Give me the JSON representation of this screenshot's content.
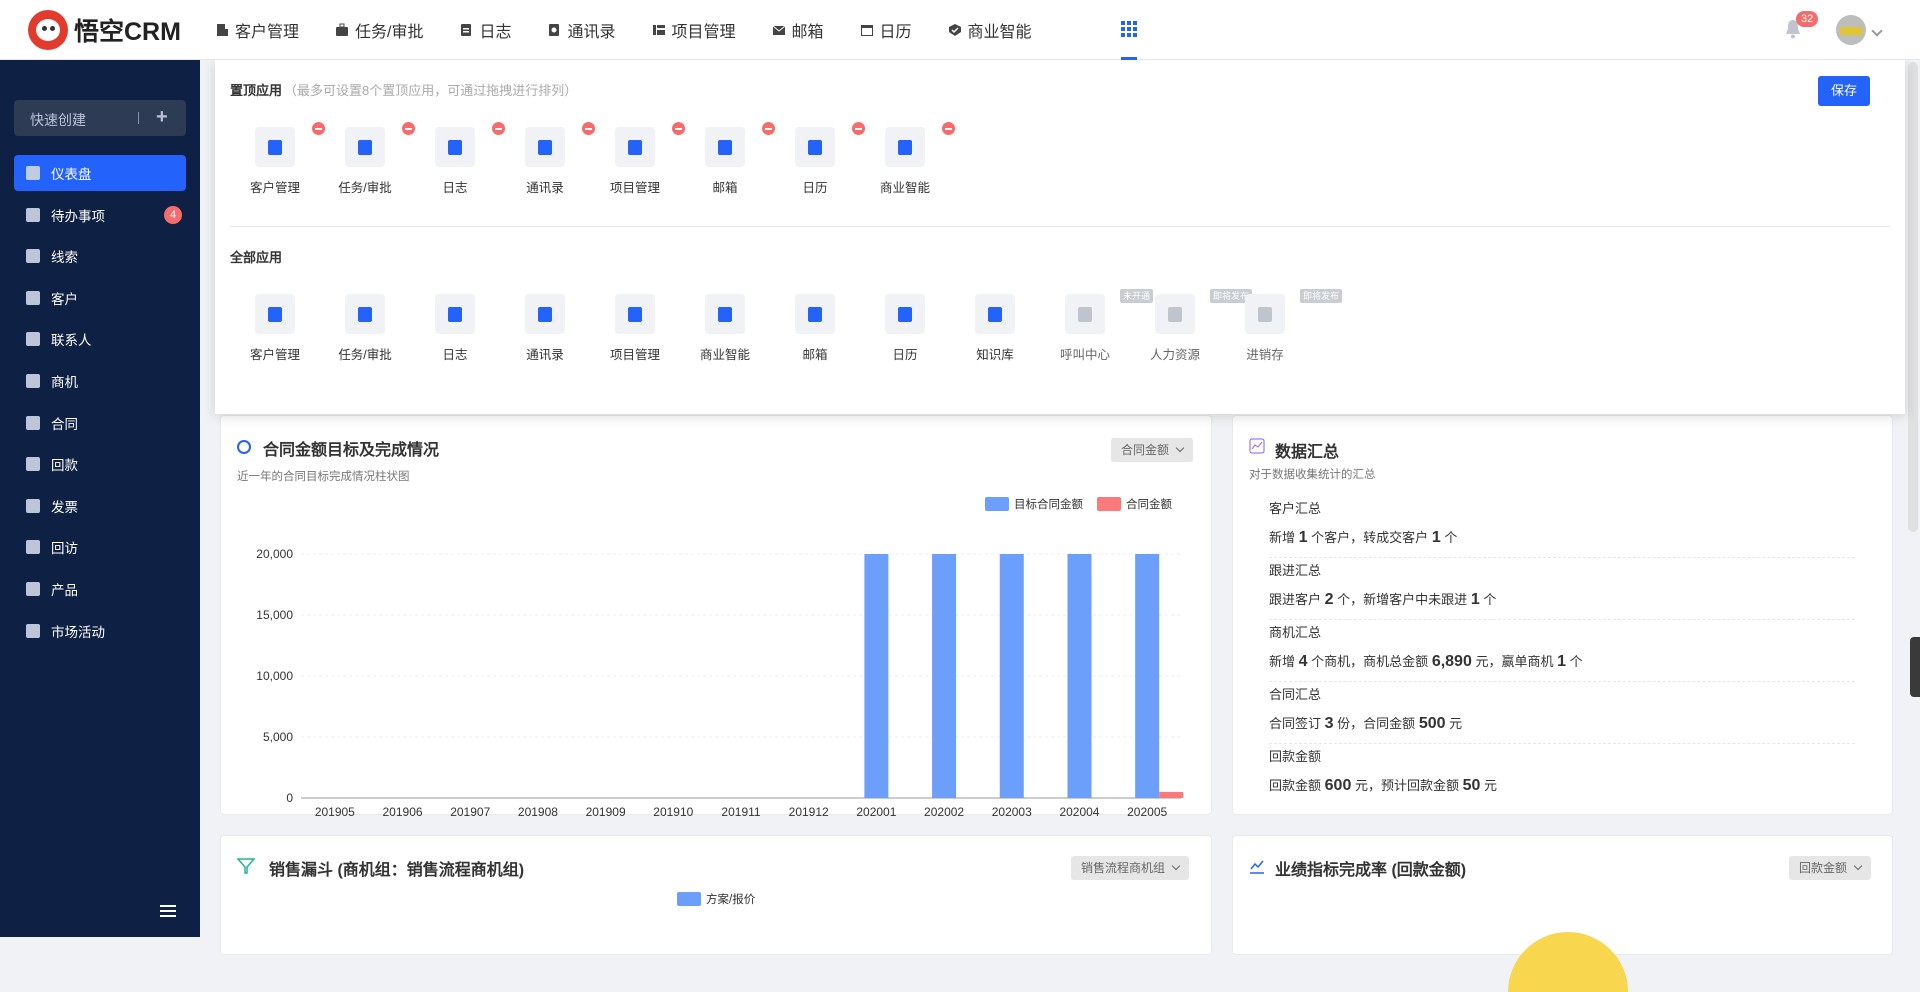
{
  "brand": {
    "name": "悟空CRM"
  },
  "topnav": [
    {
      "label": "客户管理"
    },
    {
      "label": "任务/审批"
    },
    {
      "label": "日志"
    },
    {
      "label": "通讯录"
    },
    {
      "label": "项目管理"
    },
    {
      "label": "邮箱"
    },
    {
      "label": "日历"
    },
    {
      "label": "商业智能"
    }
  ],
  "header": {
    "notifications_count": "32"
  },
  "sidebar": {
    "quick_create": "快速创建",
    "items": [
      {
        "label": "仪表盘"
      },
      {
        "label": "待办事项",
        "badge": "4"
      },
      {
        "label": "线索"
      },
      {
        "label": "客户"
      },
      {
        "label": "联系人"
      },
      {
        "label": "商机"
      },
      {
        "label": "合同"
      },
      {
        "label": "回款"
      },
      {
        "label": "发票"
      },
      {
        "label": "回访"
      },
      {
        "label": "产品"
      },
      {
        "label": "市场活动"
      }
    ]
  },
  "panel": {
    "pinned_title": "置顶应用",
    "pinned_hint": "（最多可设置8个置顶应用，可通过拖拽进行排列）",
    "save": "保存",
    "pinned": [
      {
        "label": "客户管理"
      },
      {
        "label": "任务/审批"
      },
      {
        "label": "日志"
      },
      {
        "label": "通讯录"
      },
      {
        "label": "项目管理"
      },
      {
        "label": "邮箱"
      },
      {
        "label": "日历"
      },
      {
        "label": "商业智能"
      }
    ],
    "all_title": "全部应用",
    "all": [
      {
        "label": "客户管理"
      },
      {
        "label": "任务/审批"
      },
      {
        "label": "日志"
      },
      {
        "label": "通讯录"
      },
      {
        "label": "项目管理"
      },
      {
        "label": "商业智能"
      },
      {
        "label": "邮箱"
      },
      {
        "label": "日历"
      },
      {
        "label": "知识库"
      },
      {
        "label": "呼叫中心",
        "tag": "未开通"
      },
      {
        "label": "人力资源",
        "tag": "即将发布"
      },
      {
        "label": "进销存",
        "tag": "即将发布"
      }
    ]
  },
  "contract_card": {
    "title": "合同金额目标及完成情况",
    "subtitle": "近一年的合同目标完成情况柱状图",
    "select": "合同金额"
  },
  "chart_data": {
    "type": "bar",
    "categories": [
      "201905",
      "201906",
      "201907",
      "201908",
      "201909",
      "201910",
      "201911",
      "201912",
      "202001",
      "202002",
      "202003",
      "202004",
      "202005"
    ],
    "series": [
      {
        "name": "目标合同金额",
        "values": [
          0,
          0,
          0,
          0,
          0,
          0,
          0,
          0,
          20000,
          20000,
          20000,
          20000,
          20000
        ],
        "color": "#6b9ffb"
      },
      {
        "name": "合同金额",
        "values": [
          0,
          0,
          0,
          0,
          0,
          0,
          0,
          0,
          0,
          0,
          0,
          0,
          500
        ],
        "color": "#f97a7a"
      }
    ],
    "ylim": [
      0,
      20000
    ],
    "yticks": [
      "20,000",
      "15,000",
      "10,000",
      "5,000",
      "0"
    ],
    "grid": true,
    "legend": "top-right"
  },
  "summary_card": {
    "title": "数据汇总",
    "subtitle": "对于数据收集统计的汇总",
    "items": [
      {
        "title": "客户汇总",
        "p1": "新增",
        "v1": "1",
        "p2": "个客户，转成交客户",
        "v2": "1",
        "p3": "个"
      },
      {
        "title": "跟进汇总",
        "p1": "跟进客户",
        "v1": "2",
        "p2": "个，新增客户中未跟进",
        "v2": "1",
        "p3": "个"
      },
      {
        "title": "商机汇总",
        "p1": "新增",
        "v1": "4",
        "p2": "个商机，商机总金额",
        "v2": "6,890",
        "p3": "元，赢单商机",
        "v3": "1",
        "p4": "个"
      },
      {
        "title": "合同汇总",
        "p1": "合同签订",
        "v1": "3",
        "p2": "份，合同金额",
        "v2": "500",
        "p3": "元"
      },
      {
        "title": "回款金额",
        "p1": "回款金额",
        "v1": "600",
        "p2": "元，预计回款金额",
        "v2": "50",
        "p3": "元"
      }
    ]
  },
  "funnel_card": {
    "title": "销售漏斗 (商机组：销售流程商机组)",
    "select": "销售流程商机组",
    "legend": "方案/报价"
  },
  "kpi_card": {
    "title": "业绩指标完成率 (回款金额)",
    "select": "回款金额"
  }
}
